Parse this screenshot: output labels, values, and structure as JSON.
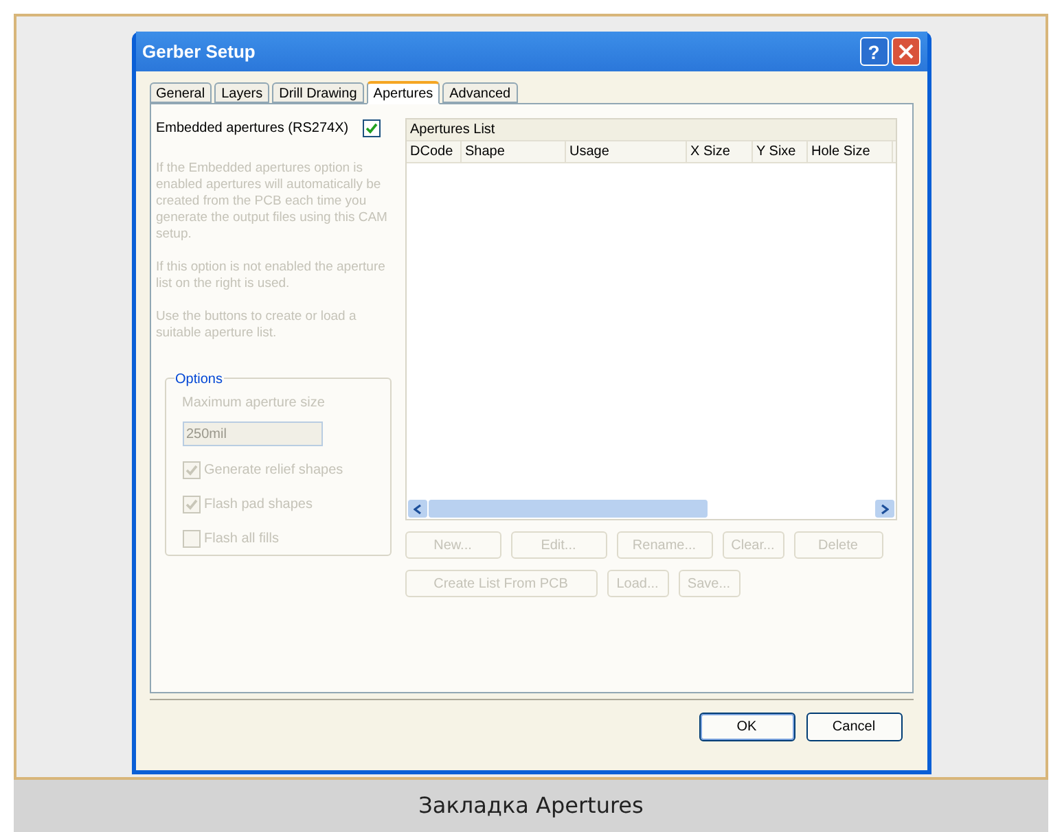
{
  "window": {
    "title": "Gerber Setup",
    "help_button": "?"
  },
  "tabs": [
    {
      "label": "General",
      "selected": false
    },
    {
      "label": "Layers",
      "selected": false
    },
    {
      "label": "Drill Drawing",
      "selected": false
    },
    {
      "label": "Apertures",
      "selected": true
    },
    {
      "label": "Advanced",
      "selected": false
    }
  ],
  "embedded": {
    "label": "Embedded apertures (RS274X)",
    "checked": true
  },
  "help_paragraphs": [
    "If the Embedded apertures option is enabled apertures will automatically be created from the PCB each time you generate the output files using this CAM setup.",
    "If this option is not enabled the aperture list on the right is used.",
    "Use the buttons to create or load a suitable aperture list."
  ],
  "options": {
    "title": "Options",
    "max_size_label": "Maximum aperture size",
    "max_size_value": "250mil",
    "checkboxes": [
      {
        "label": "Generate relief shapes",
        "checked": true,
        "disabled": true
      },
      {
        "label": "Flash pad shapes",
        "checked": true,
        "disabled": true
      },
      {
        "label": "Flash all fills",
        "checked": false,
        "disabled": true
      }
    ]
  },
  "list": {
    "title": "Apertures List",
    "columns": [
      "DCode",
      "Shape",
      "Usage",
      "X Size",
      "Y Sixe",
      "Hole Size"
    ]
  },
  "list_buttons": [
    [
      {
        "label": "New...",
        "disabled": true
      },
      {
        "label": "Edit...",
        "disabled": true
      },
      {
        "label": "Rename...",
        "disabled": true
      },
      {
        "label": "Clear...",
        "disabled": true
      },
      {
        "label": "Delete",
        "disabled": true
      }
    ],
    [
      {
        "label": "Create List From PCB",
        "disabled": true
      },
      {
        "label": "Load...",
        "disabled": true
      },
      {
        "label": "Save...",
        "disabled": true
      }
    ]
  ],
  "dialog_buttons": [
    "OK",
    "Cancel"
  ],
  "caption": "Закладка Apertures"
}
